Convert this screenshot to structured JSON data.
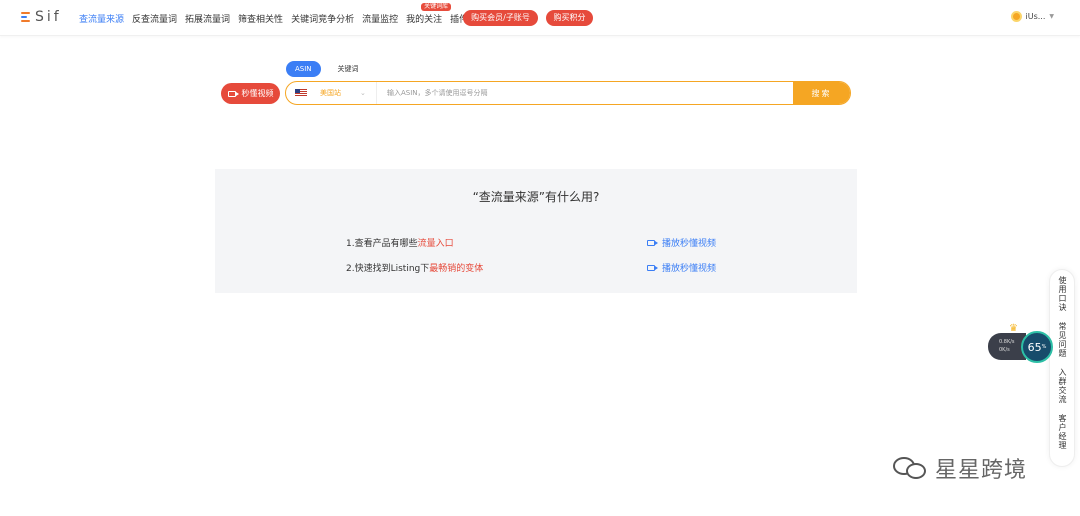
{
  "logo": {
    "text": "Sif"
  },
  "nav": {
    "items": [
      "查流量来源",
      "反查流量词",
      "拓展流量词",
      "筛查相关性",
      "关键词竞争分析",
      "流量监控",
      "我的关注",
      "插件"
    ],
    "badge": "关键词库",
    "buy_member": "购买会员/子账号",
    "buy_points": "购买积分"
  },
  "user": {
    "name": "iUs..."
  },
  "search": {
    "tabs": [
      "ASIN",
      "关键词"
    ],
    "video_button": "秒懂视频",
    "site": "美国站",
    "placeholder": "输入ASIN，多个请使用逗号分隔",
    "button": "搜索"
  },
  "panel": {
    "title": "“查流量来源”有什么用?",
    "item1_prefix": "1.查看产品有哪些",
    "item1_highlight": "流量入口",
    "item2_prefix": "2.快速找到Listing下",
    "item2_highlight": "最畅销的变体",
    "play_label": "播放秒懂视频"
  },
  "side": {
    "items": [
      "使用口诀",
      "常见问题",
      "入群交流",
      "客户经理"
    ]
  },
  "speed": {
    "up": "0.8K/s",
    "down": "0K/s",
    "percent": "65",
    "percent_unit": "%"
  },
  "watermark": "星星跨境",
  "colors": {
    "accent": "#3b7ef5",
    "red": "#e64a3b",
    "orange": "#f5a623"
  }
}
